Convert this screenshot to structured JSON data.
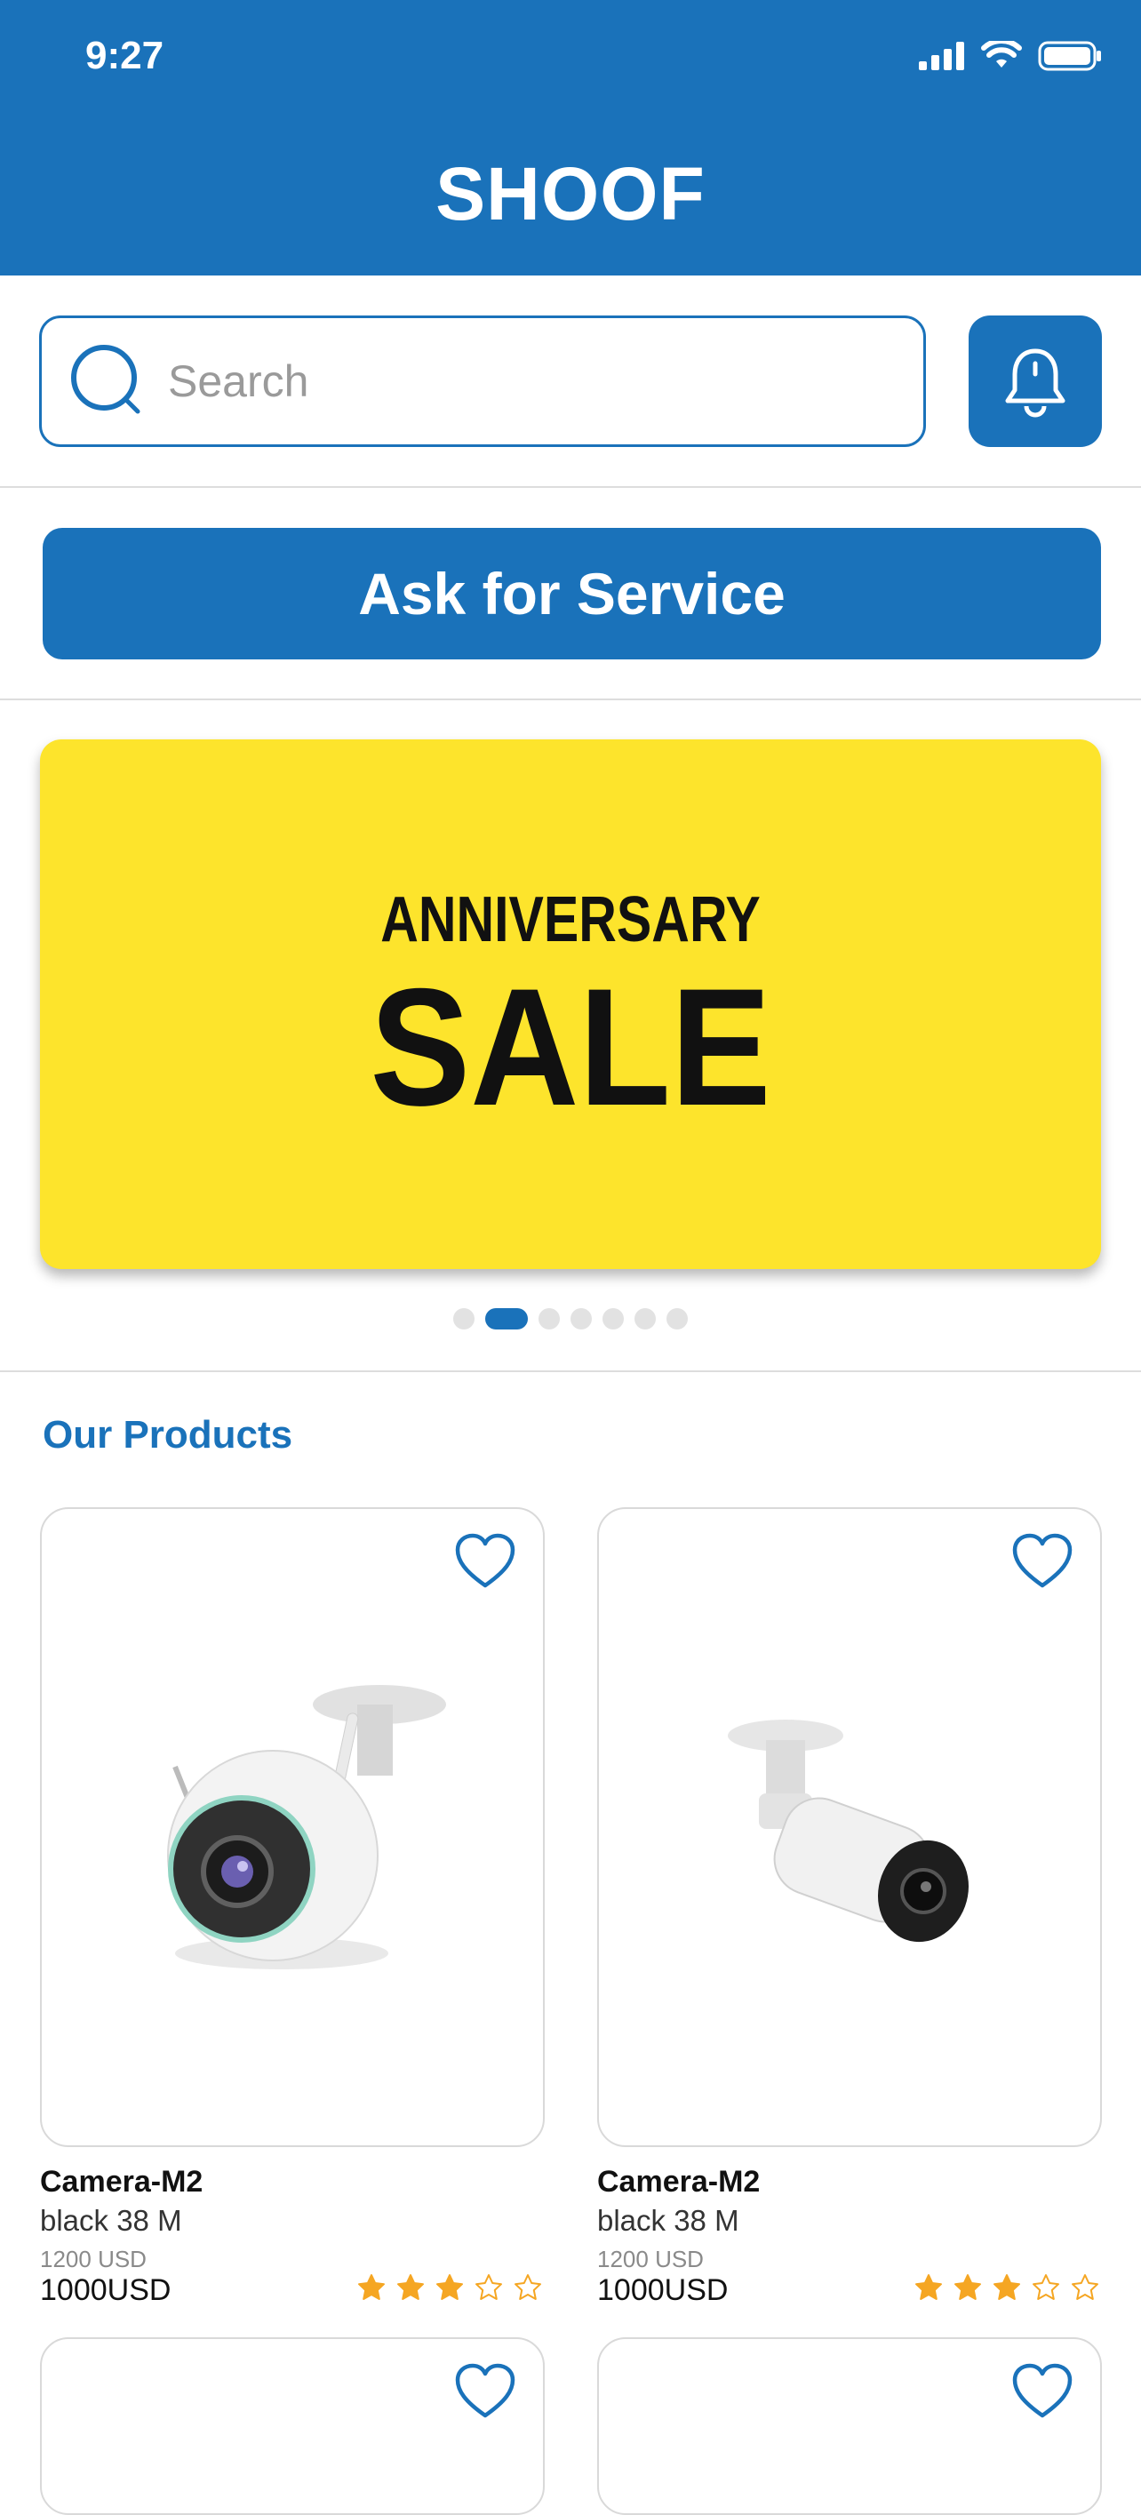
{
  "status_bar": {
    "time": "9:27"
  },
  "header": {
    "title": "SHOOF"
  },
  "search": {
    "placeholder": "Search"
  },
  "actions": {
    "service_button": "Ask for Service"
  },
  "banner": {
    "line1": "ANNIVERSARY",
    "line2": "SALE",
    "slides_total": 7,
    "active_slide": 2
  },
  "products_section": {
    "title": "Our Products"
  },
  "products": [
    {
      "name": "Camera-M2",
      "variant": "black 38 M",
      "old_price": "1200 USD",
      "price": "1000USD",
      "rating": 3,
      "rating_max": 5
    },
    {
      "name": "Camera-M2",
      "variant": "black 38 M",
      "old_price": "1200 USD",
      "price": "1000USD",
      "rating": 3,
      "rating_max": 5
    }
  ],
  "colors": {
    "brand": "#1a72ba",
    "banner": "#fde42c",
    "star": "#f5a623"
  },
  "icons": [
    "signal-icon",
    "wifi-icon",
    "battery-icon",
    "search-icon",
    "bell-icon",
    "heart-icon",
    "star-icon"
  ]
}
